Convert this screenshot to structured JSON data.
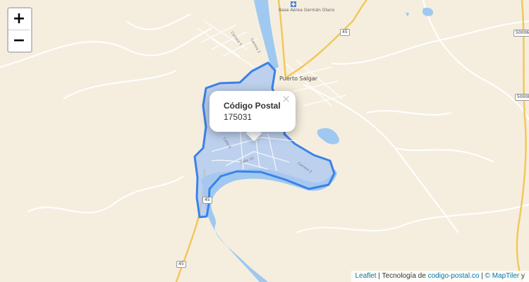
{
  "map": {
    "labels": {
      "airport": "Base Aérea Germán Olano",
      "town": "Puerto Salgar",
      "street_a": "Carrera 5",
      "street_b": "Carrera 2",
      "street_c": "Calle 9",
      "street_d": "Calle 10",
      "street_e": "Carrera 2"
    },
    "road_shields": {
      "a": "45",
      "b": "45",
      "c": "45",
      "d": "50006",
      "e": "50008"
    }
  },
  "zoom": {
    "in_label": "+",
    "out_label": "−"
  },
  "popup": {
    "title": "Código Postal",
    "value": "175031",
    "close_label": "×"
  },
  "attribution": {
    "leaflet": "Leaflet",
    "sep1": " | Tecnología de ",
    "site": "codigo-postal.co",
    "sep2": " | ",
    "maptiler": "© MapTiler",
    "tail": " y"
  },
  "colors": {
    "land": "#f5eedf",
    "water": "#9fc9f0",
    "polygon_fill": "#a9c6f2",
    "polygon_stroke": "#3b82e8",
    "road_major": "#f2c75c",
    "road_minor": "#ffffff",
    "link": "#0078a8"
  }
}
